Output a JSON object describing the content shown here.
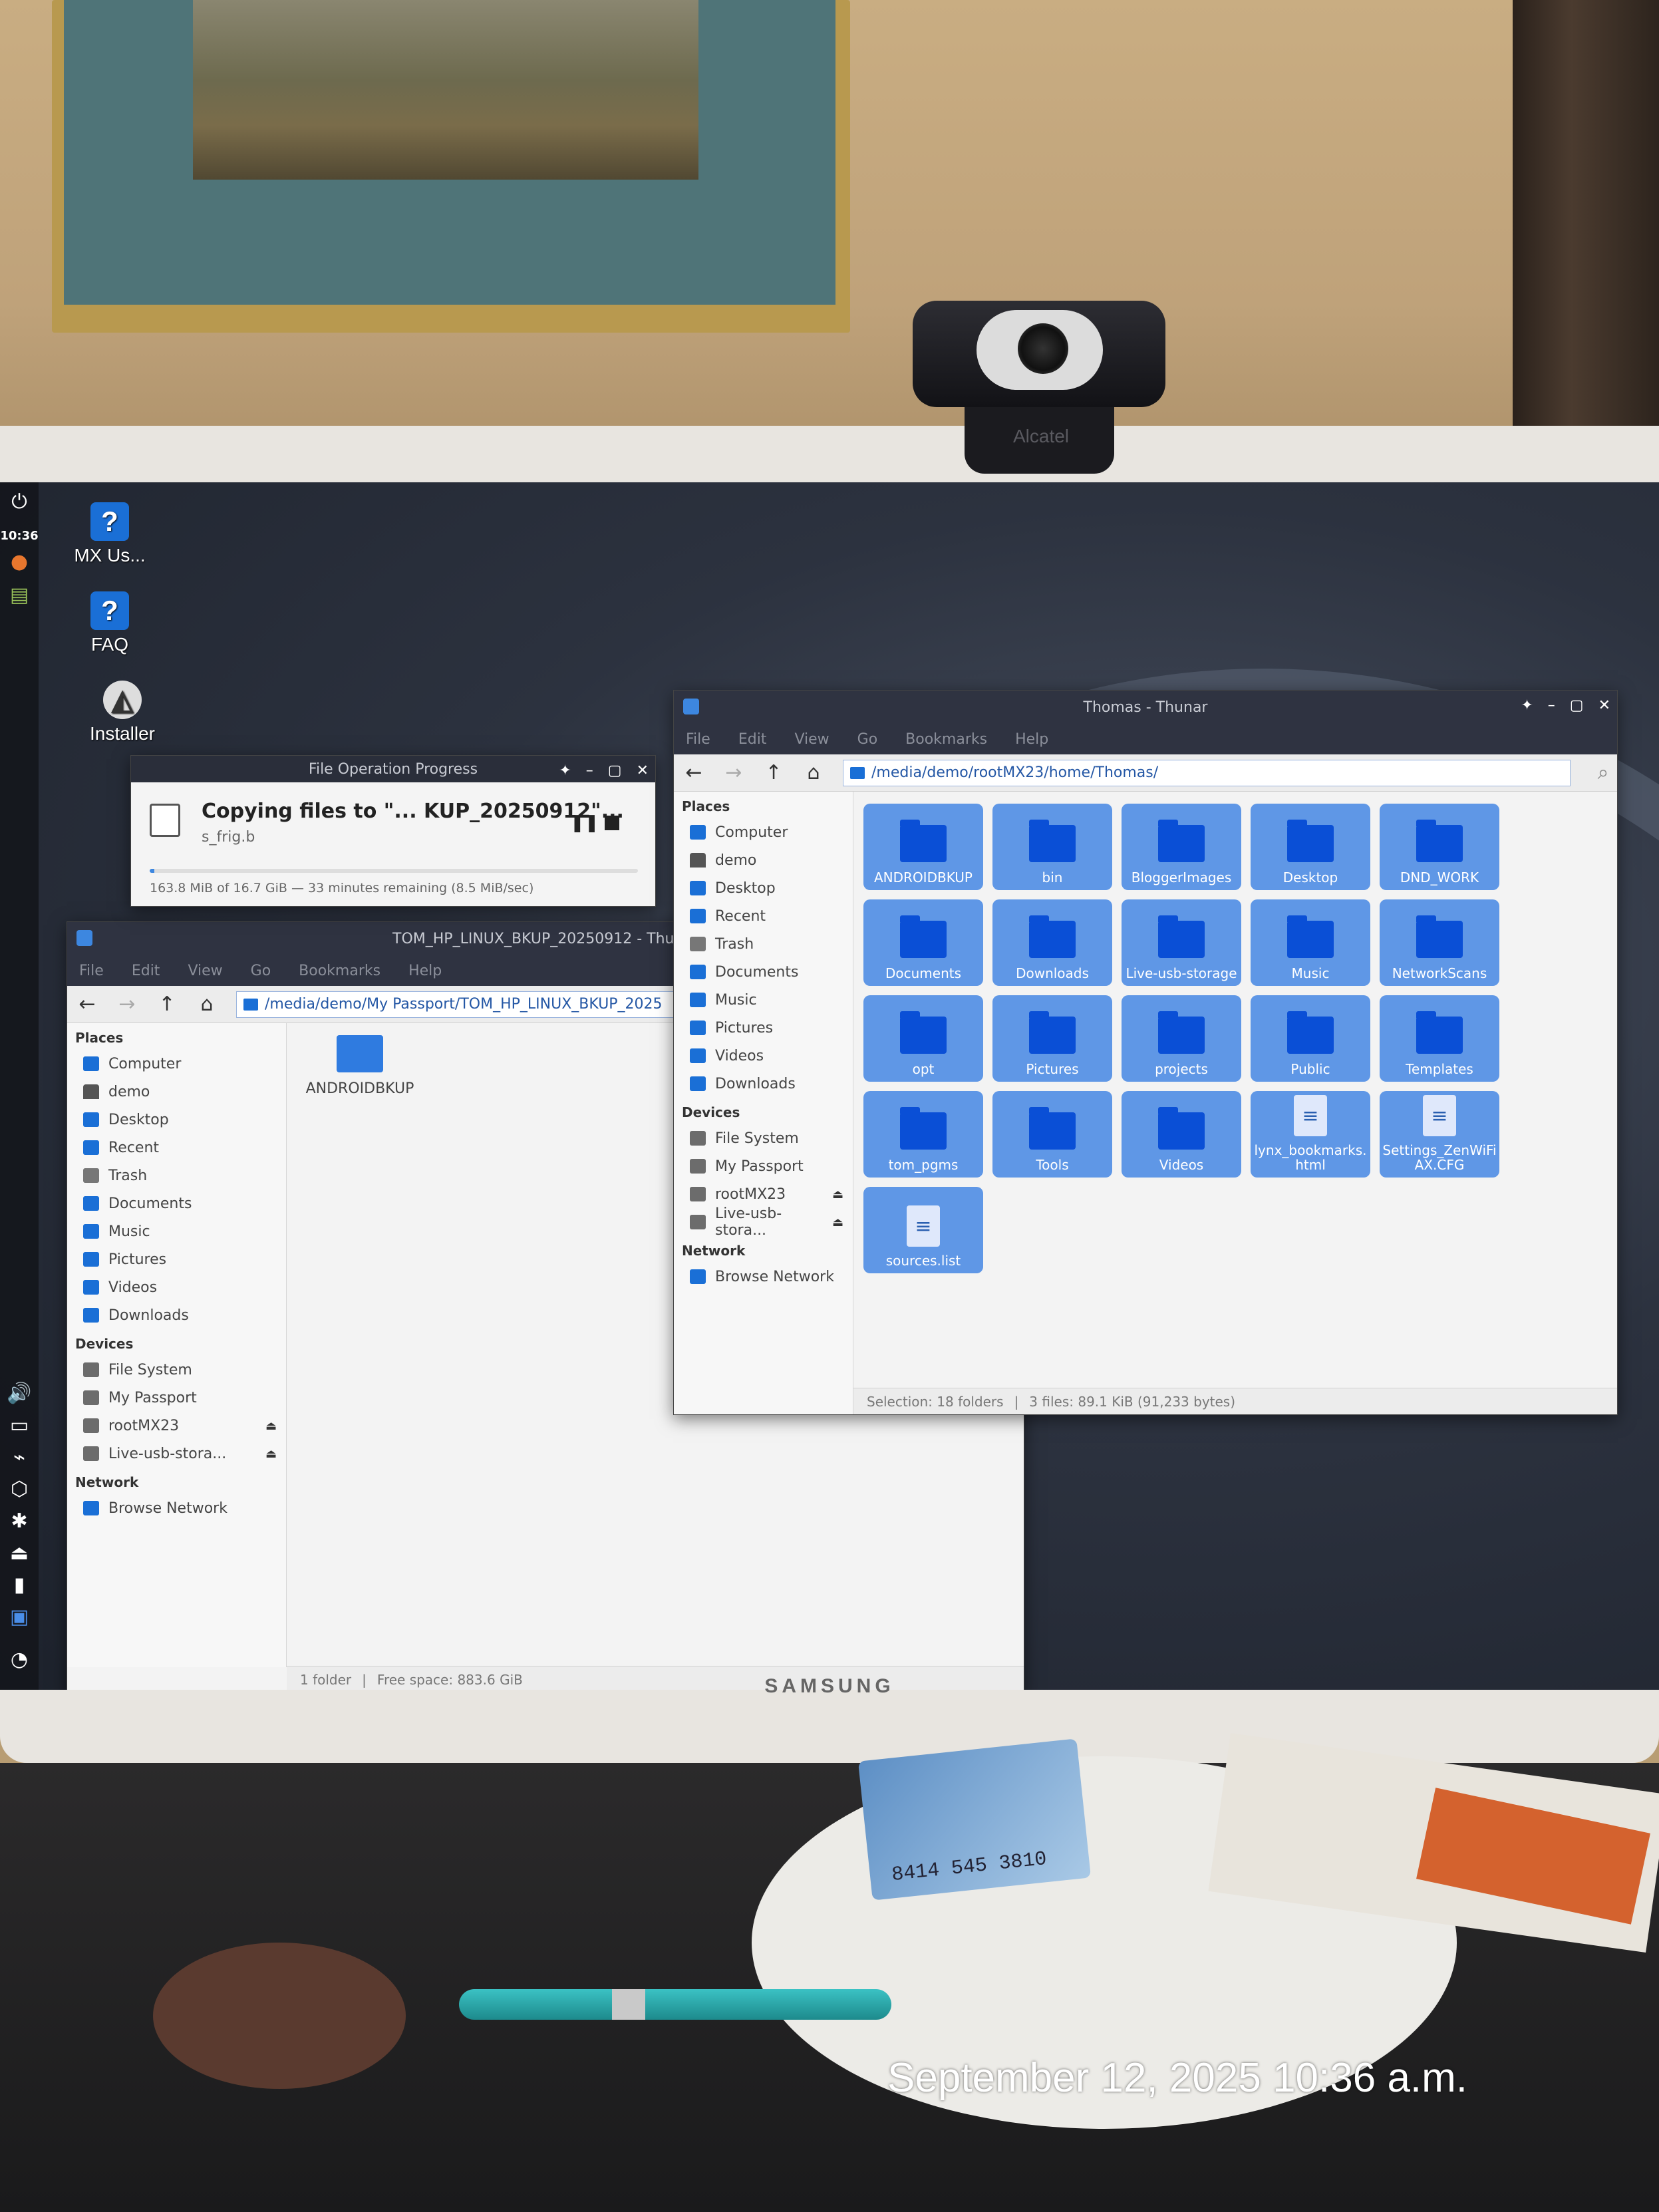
{
  "desktop": {
    "clock": "10:36",
    "icons": [
      {
        "label": "MX Us..."
      },
      {
        "label": "FAQ"
      },
      {
        "label": "Installer"
      }
    ]
  },
  "progress_dialog": {
    "title": "File Operation Progress",
    "message": "Copying files to \"... KUP_20250912\"...",
    "current_file": "s_frig.b",
    "progress_text": "163.8 MiB of 16.7 GiB — 33 minutes remaining (8.5 MiB/sec)",
    "progress_fraction": 0.01
  },
  "left_window": {
    "title": "TOM_HP_LINUX_BKUP_20250912 - Thunar",
    "menu": [
      "File",
      "Edit",
      "View",
      "Go",
      "Bookmarks",
      "Help"
    ],
    "path": "/media/demo/My Passport/TOM_HP_LINUX_BKUP_2025",
    "places_header": "Places",
    "places": [
      "Computer",
      "demo",
      "Desktop",
      "Recent",
      "Trash",
      "Documents",
      "Music",
      "Pictures",
      "Videos",
      "Downloads"
    ],
    "devices_header": "Devices",
    "devices": [
      "File System",
      "My Passport",
      "rootMX23",
      "Live-usb-stora..."
    ],
    "network_header": "Network",
    "network": [
      "Browse Network"
    ],
    "items": [
      "ANDROIDBKUP"
    ],
    "status_count": "1 folder",
    "status_free": "Free space: 883.6 GiB"
  },
  "right_window": {
    "title": "Thomas - Thunar",
    "menu": [
      "File",
      "Edit",
      "View",
      "Go",
      "Bookmarks",
      "Help"
    ],
    "path": "/media/demo/rootMX23/home/Thomas/",
    "places_header": "Places",
    "places": [
      "Computer",
      "demo",
      "Desktop",
      "Recent",
      "Trash",
      "Documents",
      "Music",
      "Pictures",
      "Videos",
      "Downloads"
    ],
    "devices_header": "Devices",
    "devices": [
      "File System",
      "My Passport",
      "rootMX23",
      "Live-usb-stora..."
    ],
    "network_header": "Network",
    "network": [
      "Browse Network"
    ],
    "items": [
      {
        "label": "ANDROIDBKUP",
        "kind": "folder"
      },
      {
        "label": "bin",
        "kind": "folder"
      },
      {
        "label": "BloggerImages",
        "kind": "folder"
      },
      {
        "label": "Desktop",
        "kind": "folder"
      },
      {
        "label": "DND_WORK",
        "kind": "folder"
      },
      {
        "label": "Documents",
        "kind": "folder"
      },
      {
        "label": "Downloads",
        "kind": "folder"
      },
      {
        "label": "Live-usb-storage",
        "kind": "folder"
      },
      {
        "label": "Music",
        "kind": "folder"
      },
      {
        "label": "NetworkScans",
        "kind": "folder"
      },
      {
        "label": "opt",
        "kind": "folder"
      },
      {
        "label": "Pictures",
        "kind": "folder"
      },
      {
        "label": "projects",
        "kind": "folder"
      },
      {
        "label": "Public",
        "kind": "folder"
      },
      {
        "label": "Templates",
        "kind": "folder"
      },
      {
        "label": "tom_pgms",
        "kind": "folder"
      },
      {
        "label": "Tools",
        "kind": "folder"
      },
      {
        "label": "Videos",
        "kind": "folder"
      },
      {
        "label": "lynx_bookmarks.html",
        "kind": "file"
      },
      {
        "label": "Settings_ZenWiFi AX.CFG",
        "kind": "file"
      },
      {
        "label": "sources.list",
        "kind": "file"
      }
    ],
    "status_selection": "Selection: 18 folders",
    "status_files": "3 files: 89.1 KiB (91,233 bytes)"
  },
  "photo": {
    "monitor_brand": "SAMSUNG",
    "webcam_brand": "Alcatel",
    "card_number": "8414 545 3810",
    "timestamp": "September 12, 2025 10:36 a.m."
  },
  "colors": {
    "accent": "#1a6fd6",
    "selection": "#5f97e6",
    "titlebar": "#2f3341"
  }
}
